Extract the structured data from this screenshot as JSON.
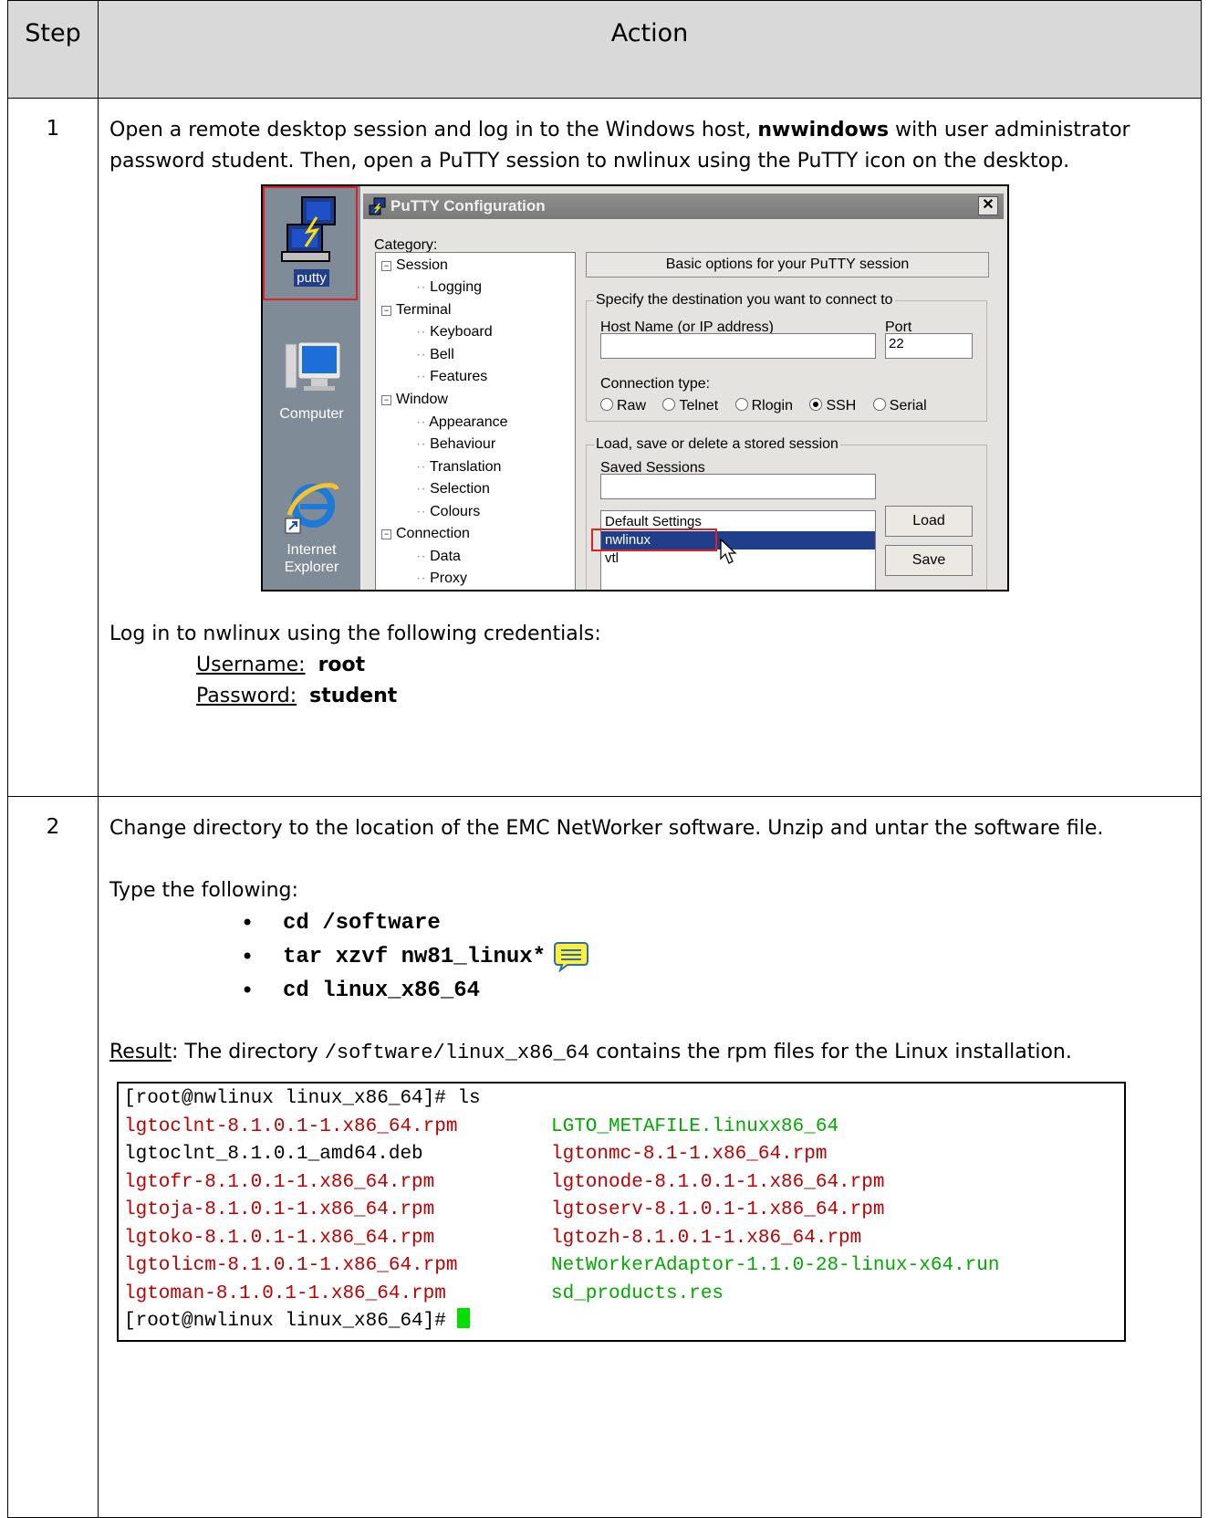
{
  "header": {
    "step": "Step",
    "action": "Action"
  },
  "step1": {
    "num": "1",
    "intro_a": "Open a remote desktop session and log in to the Windows host, ",
    "intro_host": "nwwindows",
    "intro_b": " with user administrator password student. Then, open a PuTTY session to nwlinux using the PuTTY icon on the desktop.",
    "desktop": {
      "putty": "putty",
      "computer": "Computer",
      "ie_line1": "Internet",
      "ie_line2": "Explorer"
    },
    "putty_window": {
      "title": "PuTTY Configuration",
      "close": "✕",
      "category_label": "Category:",
      "tree": [
        "Session",
        "Logging",
        "Terminal",
        "Keyboard",
        "Bell",
        "Features",
        "Window",
        "Appearance",
        "Behaviour",
        "Translation",
        "Selection",
        "Colours",
        "Connection",
        "Data",
        "Proxy"
      ],
      "panel_title": "Basic options for your PuTTY session",
      "dest_legend": "Specify the destination you want to connect to",
      "host_label": "Host Name (or IP address)",
      "host_value": "",
      "port_label": "Port",
      "port_value": "22",
      "conn_type_label": "Connection type:",
      "conn_types": [
        "Raw",
        "Telnet",
        "Rlogin",
        "SSH",
        "Serial"
      ],
      "conn_selected": "SSH",
      "load_legend": "Load, save or delete a stored session",
      "saved_sessions_label": "Saved Sessions",
      "saved_sessions_value": "",
      "sessions": [
        "Default Settings",
        "nwlinux",
        "vtl"
      ],
      "selected_session": "nwlinux",
      "load_button": "Load",
      "save_button": "Save"
    },
    "login_intro": "Log in to nwlinux using the following credentials:",
    "username_label": "Username:",
    "username": "root",
    "password_label": "Password:",
    "password": "student"
  },
  "step2": {
    "num": "2",
    "intro": "Change directory to the location of the EMC NetWorker software. Unzip and untar the software file.",
    "type_following": "Type the following:",
    "commands": [
      "cd /software",
      "tar xzvf nw81_linux*",
      "cd linux_x86_64"
    ],
    "result_label": "Result",
    "result_a": ": The directory ",
    "result_path": "/software/linux_x86_64",
    "result_b": " contains the rpm files for the Linux installation.",
    "terminal": {
      "prompt_cmd": "[root@nwlinux linux_x86_64]# ls",
      "rows": [
        [
          "lgtoclnt-8.1.0.1-1.x86_64.rpm",
          "LGTO_METAFILE.linuxx86_64"
        ],
        [
          "lgtoclnt_8.1.0.1_amd64.deb",
          "lgtonmc-8.1-1.x86_64.rpm"
        ],
        [
          "lgtofr-8.1.0.1-1.x86_64.rpm",
          "lgtonode-8.1.0.1-1.x86_64.rpm"
        ],
        [
          "lgtoja-8.1.0.1-1.x86_64.rpm",
          "lgtoserv-8.1.0.1-1.x86_64.rpm"
        ],
        [
          "lgtoko-8.1.0.1-1.x86_64.rpm",
          "lgtozh-8.1.0.1-1.x86_64.rpm"
        ],
        [
          "lgtolicm-8.1.0.1-1.x86_64.rpm",
          "NetWorkerAdaptor-1.1.0-28-linux-x64.run"
        ],
        [
          "lgtoman-8.1.0.1-1.x86_64.rpm",
          "sd_products.res"
        ]
      ],
      "prompt_end": "[root@nwlinux linux_x86_64]# "
    }
  },
  "colors": {
    "header_bg": "#d9d9d9",
    "rpm_red": "#c00000",
    "exec_green": "#00aa00",
    "highlight_red": "#e02020",
    "selection_blue": "#203e8a",
    "note_yellow": "#ffef3a"
  }
}
